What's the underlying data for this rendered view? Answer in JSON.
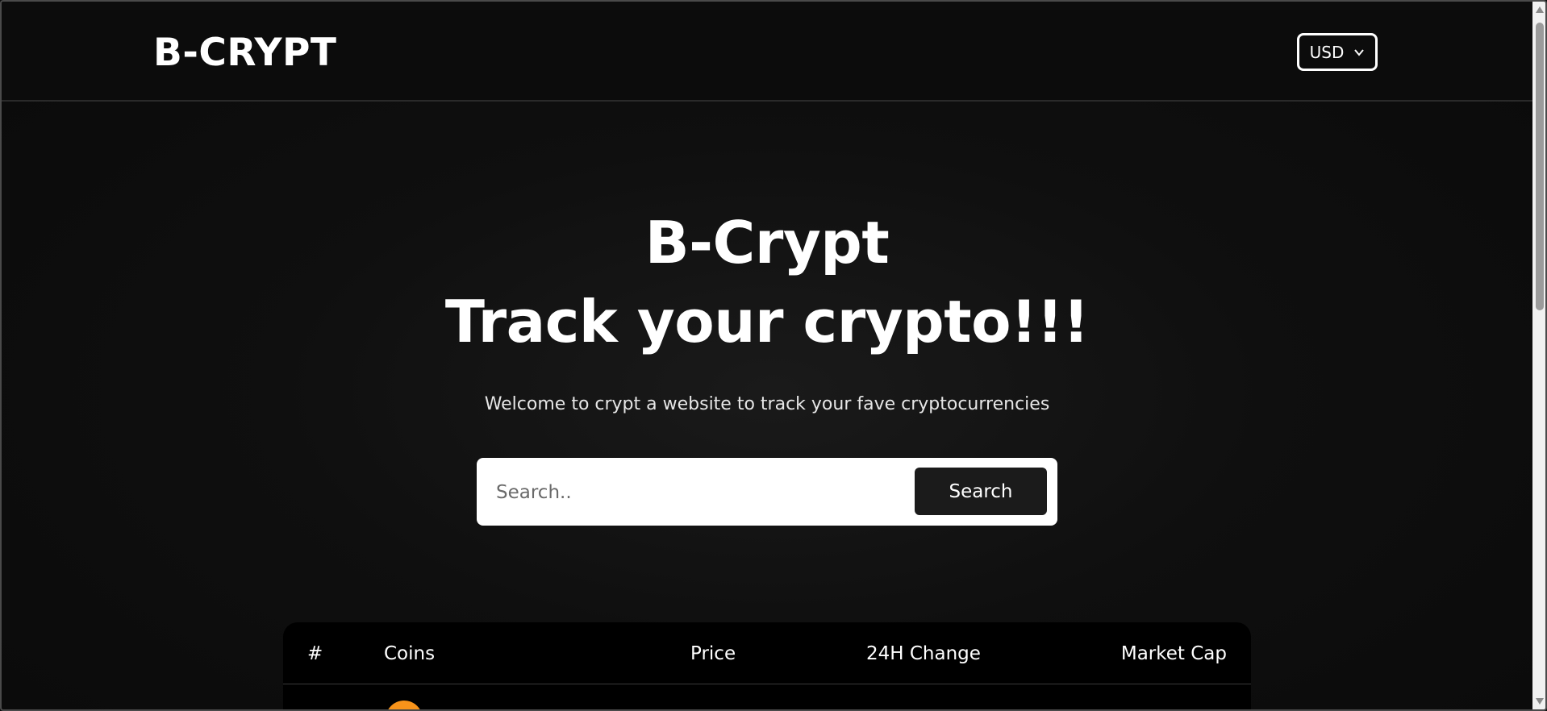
{
  "navbar": {
    "logo": "B-CRYPT",
    "currency": {
      "selected": "USD"
    }
  },
  "hero": {
    "title_line1": "B-Crypt",
    "title_line2": "Track your crypto!!!",
    "subtitle": "Welcome to crypt a website to track your fave cryptocurrencies"
  },
  "search": {
    "placeholder": "Search..",
    "value": "",
    "button_label": "Search"
  },
  "table": {
    "headers": {
      "rank": "#",
      "coins": "Coins",
      "price": "Price",
      "change": "24H Change",
      "market_cap": "Market Cap"
    },
    "first_row_icon": "bitcoin-icon",
    "first_row_icon_color": "#f7931a"
  },
  "colors": {
    "background": "#0b0b0b",
    "table_background": "#000000",
    "search_box": "#ffffff",
    "search_button": "#1b1b1b"
  }
}
